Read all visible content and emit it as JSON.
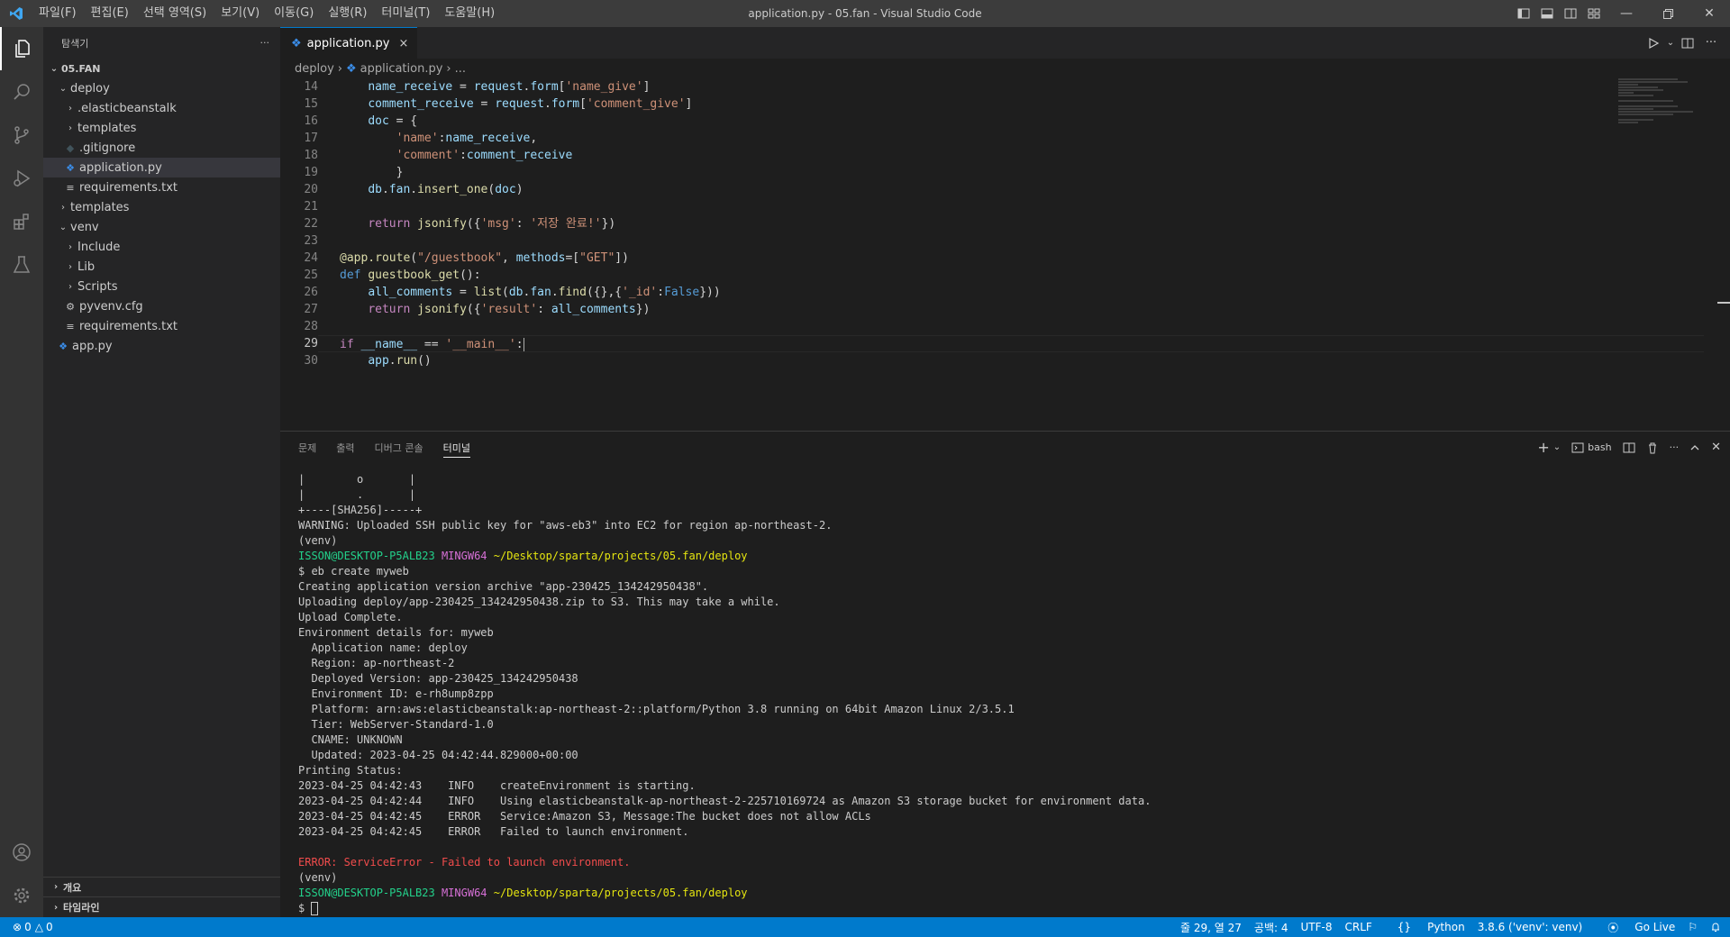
{
  "window": {
    "title": "application.py - 05.fan - Visual Studio Code",
    "menu": [
      "파일(F)",
      "편집(E)",
      "선택 영역(S)",
      "보기(V)",
      "이동(G)",
      "실행(R)",
      "터미널(T)",
      "도움말(H)"
    ]
  },
  "colors": {
    "accent": "#007acc",
    "activitybar": "#333333",
    "sidebar": "#252526",
    "editor": "#1e1e1e"
  },
  "sidebar": {
    "header": "탐색기",
    "more": "···",
    "root": "05.FAN",
    "items": [
      {
        "label": "deploy",
        "type": "folder",
        "expanded": true
      },
      {
        "label": ".elasticbeanstalk",
        "type": "folder",
        "expanded": false
      },
      {
        "label": "templates",
        "type": "folder",
        "expanded": false
      },
      {
        "label": ".gitignore",
        "type": "file",
        "icon": "git-icon"
      },
      {
        "label": "application.py",
        "type": "file",
        "icon": "python-icon",
        "selected": true
      },
      {
        "label": "requirements.txt",
        "type": "file",
        "icon": "text-icon"
      },
      {
        "label": "templates",
        "type": "folder",
        "expanded": false
      },
      {
        "label": "venv",
        "type": "folder",
        "expanded": true
      },
      {
        "label": "Include",
        "type": "folder",
        "expanded": false
      },
      {
        "label": "Lib",
        "type": "folder",
        "expanded": false
      },
      {
        "label": "Scripts",
        "type": "folder",
        "expanded": false
      },
      {
        "label": "pyvenv.cfg",
        "type": "file",
        "icon": "gear-icon"
      },
      {
        "label": "requirements.txt",
        "type": "file",
        "icon": "text-icon"
      },
      {
        "label": "app.py",
        "type": "file",
        "icon": "python-icon"
      }
    ],
    "sections": [
      "개요",
      "타임라인"
    ]
  },
  "editor": {
    "tab": "application.py",
    "close": "×",
    "breadcrumb": {
      "folder": "deploy",
      "file": "application.py",
      "rest": "..."
    },
    "line_numbers": [
      "14",
      "15",
      "16",
      "17",
      "18",
      "19",
      "20",
      "21",
      "22",
      "23",
      "24",
      "25",
      "26",
      "27",
      "28",
      "29",
      "30"
    ],
    "code": [
      "    name_receive = request.form['name_give']",
      "    comment_receive = request.form['comment_give']",
      "    doc = {",
      "        'name':name_receive,",
      "        'comment':comment_receive",
      "        }",
      "    db.fan.insert_one(doc)",
      "",
      "    return jsonify({'msg': '저장 완료!'})",
      "",
      "@app.route(\"/guestbook\", methods=[\"GET\"])",
      "def guestbook_get():",
      "    all_comments = list(db.fan.find({},{'_id':False}))",
      "    return jsonify({'result': all_comments})",
      "",
      "if __name__ == '__main__':",
      "    app.run()"
    ]
  },
  "panel": {
    "tabs": [
      "문제",
      "출력",
      "디버그 콘솔",
      "터미널"
    ],
    "active_tab": "터미널",
    "shell": "bash",
    "terminal": {
      "art1": "|        o       |",
      "art2": "|        .       |",
      "art3": "+----[SHA256]-----+",
      "warning": "WARNING: Uploaded SSH public key for \"aws-eb3\" into EC2 for region ap-northeast-2.",
      "venv": "(venv)",
      "prompt_user": "ISSON@DESKTOP-P5ALB23",
      "prompt_host": "MINGW64",
      "prompt_path": "~/Desktop/sparta/projects/05.fan/deploy",
      "cmd": "$ eb create myweb",
      "out": [
        "Creating application version archive \"app-230425_134242950438\".",
        "Uploading deploy/app-230425_134242950438.zip to S3. This may take a while.",
        "Upload Complete.",
        "Environment details for: myweb",
        "  Application name: deploy",
        "  Region: ap-northeast-2",
        "  Deployed Version: app-230425_134242950438",
        "  Environment ID: e-rh8ump8zpp",
        "  Platform: arn:aws:elasticbeanstalk:ap-northeast-2::platform/Python 3.8 running on 64bit Amazon Linux 2/3.5.1",
        "  Tier: WebServer-Standard-1.0",
        "  CNAME: UNKNOWN",
        "  Updated: 2023-04-25 04:42:44.829000+00:00",
        "Printing Status:",
        "2023-04-25 04:42:43    INFO    createEnvironment is starting.",
        "2023-04-25 04:42:44    INFO    Using elasticbeanstalk-ap-northeast-2-225710169724 as Amazon S3 storage bucket for environment data.",
        "2023-04-25 04:42:45    ERROR   Service:Amazon S3, Message:The bucket does not allow ACLs",
        "2023-04-25 04:42:45    ERROR   Failed to launch environment."
      ],
      "error": "ERROR: ServiceError - Failed to launch environment.",
      "dollar": "$ "
    }
  },
  "statusbar": {
    "errors": "0",
    "warnings": "0",
    "position": "줄 29, 열 27",
    "spaces": "공백: 4",
    "encoding": "UTF-8",
    "eol": "CRLF",
    "language": "Python",
    "interpreter": "3.8.6 ('venv': venv)",
    "golive": "Go Live"
  }
}
